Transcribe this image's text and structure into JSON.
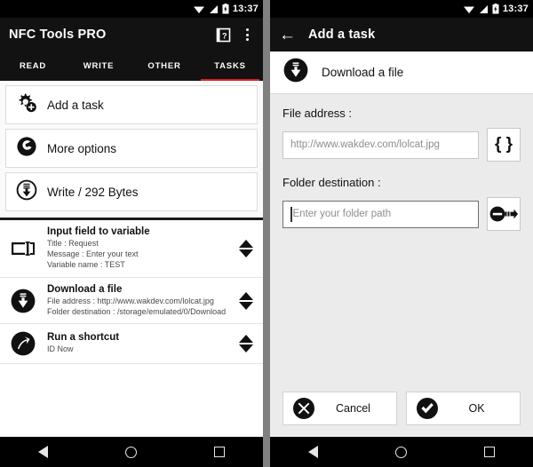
{
  "status_bar": {
    "time": "13:37",
    "icons": [
      "wifi-icon",
      "signal-icon",
      "battery-icon"
    ]
  },
  "left_panel": {
    "app_bar": {
      "title": "NFC Tools PRO",
      "help_icon": "help-book-icon",
      "overflow_icon": "kebab-menu-icon"
    },
    "tabs": [
      {
        "label": "READ",
        "active": false
      },
      {
        "label": "WRITE",
        "active": false
      },
      {
        "label": "OTHER",
        "active": false
      },
      {
        "label": "TASKS",
        "active": true
      }
    ],
    "accent_color": "#e02020",
    "cards": [
      {
        "label": "Add a task",
        "icon": "gear-plus-icon"
      },
      {
        "label": "More options",
        "icon": "wrench-circle-icon"
      },
      {
        "label": "Write / 292 Bytes",
        "icon": "write-download-icon"
      }
    ],
    "tasks": [
      {
        "title": "Input field to variable",
        "icon": "input-field-icon",
        "details": [
          "Title : Request",
          "Message : Enter your text",
          "Variable name : TEST"
        ]
      },
      {
        "title": "Download a file",
        "icon": "download-circle-icon",
        "details": [
          "File address : http://www.wakdev.com/lolcat.jpg",
          "Folder destination : /storage/emulated/0/Download"
        ]
      },
      {
        "title": "Run a shortcut",
        "icon": "shortcut-arrow-icon",
        "details": [
          "ID Now"
        ]
      }
    ]
  },
  "right_panel": {
    "app_bar": {
      "title": "Add a task",
      "back_icon": "back-arrow-icon"
    },
    "task_header": {
      "label": "Download a file",
      "icon": "download-circle-icon"
    },
    "fields": [
      {
        "label": "File address :",
        "value": "",
        "placeholder": "http://www.wakdev.com/lolcat.jpg",
        "focused": false,
        "action_button": {
          "name": "variables-button",
          "glyph": "{ }"
        }
      },
      {
        "label": "Folder destination :",
        "value": "",
        "placeholder": "Enter your folder path",
        "focused": true,
        "action_button": {
          "name": "browse-folder-button",
          "glyph": "folder-arrow-icon"
        }
      }
    ],
    "buttons": [
      {
        "label": "Cancel",
        "icon": "cancel-x-icon"
      },
      {
        "label": "OK",
        "icon": "confirm-check-icon"
      }
    ]
  },
  "nav_bar": {
    "back": "nav-back-icon",
    "home": "nav-home-icon",
    "recents": "nav-recents-icon"
  }
}
